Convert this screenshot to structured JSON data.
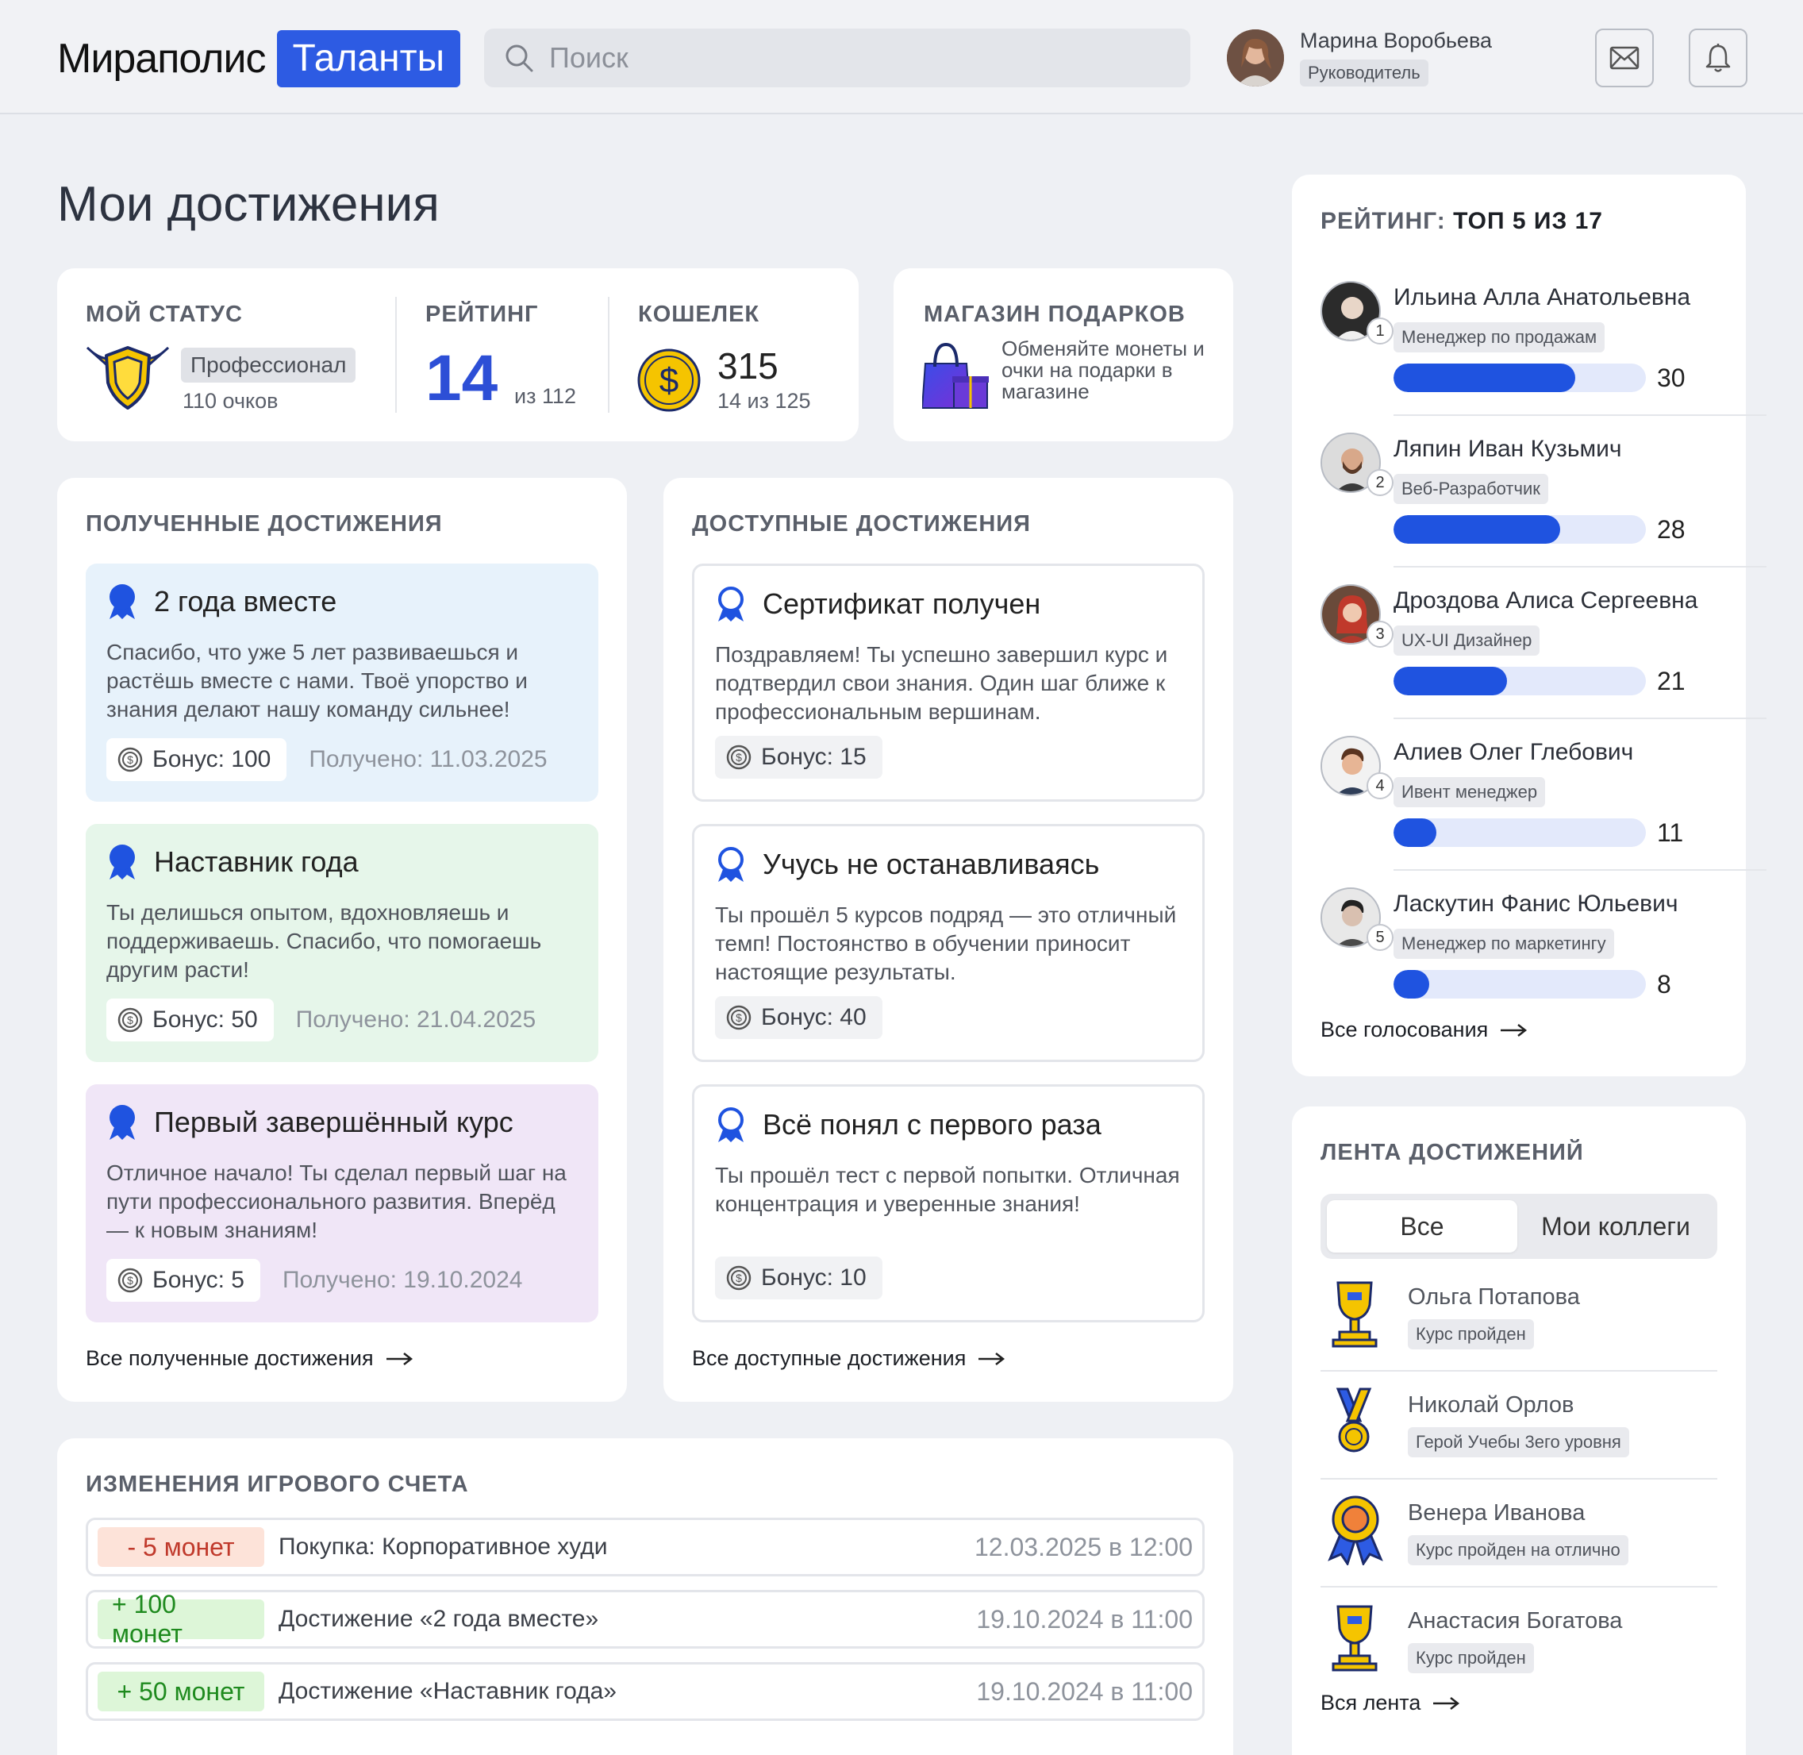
{
  "header": {
    "logo": "Мираполис",
    "logo_badge": "Таланты",
    "search_placeholder": "Поиск",
    "user_name": "Марина Воробьева",
    "user_role": "Руководитель"
  },
  "page_title": "Мои достижения",
  "status": {
    "label": "МОЙ СТАТУС",
    "level": "Профессионал",
    "points": "110 очков"
  },
  "rating": {
    "label": "РЕЙТИНГ",
    "value": "14",
    "total": "из 112"
  },
  "wallet": {
    "label": "КОШЕЛЕК",
    "value": "315",
    "sub": "14 из 125"
  },
  "shop": {
    "label": "МАГАЗИН ПОДАРКОВ",
    "text": "Обменяйте монеты и очки на подарки в магазине"
  },
  "received": {
    "title": "ПОЛУЧЕННЫЕ ДОСТИЖЕНИЯ",
    "items": [
      {
        "title": "2 года вместе",
        "text": "Спасибо, что уже 5 лет развиваешься и растёшь вместе с нами. Твоё упорство и знания делают нашу команду сильнее!",
        "bonus": "Бонус: 100",
        "date": "Получено: 11.03.2025",
        "color": "#e7f2fb"
      },
      {
        "title": "Наставник года",
        "text": "Ты делишься опытом, вдохновляешь и поддерживаешь. Спасибо, что помогаешь другим расти!",
        "bonus": "Бонус: 50",
        "date": "Получено: 21.04.2025",
        "color": "#e6f6ea"
      },
      {
        "title": "Первый завершённый курс",
        "text": "Отличное начало! Ты сделал первый шаг на пути профессионального развития. Вперёд — к новым знаниям!",
        "bonus": "Бонус: 5",
        "date": "Получено: 19.10.2024",
        "color": "#f0e6f7"
      }
    ],
    "link": "Все полученные достижения"
  },
  "available": {
    "title": "ДОСТУПНЫЕ ДОСТИЖЕНИЯ",
    "items": [
      {
        "title": "Сертификат получен",
        "text": "Поздравляем! Ты успешно завершил курс и подтвердил свои знания. Один шаг ближе к профессиональным вершинам.",
        "bonus": "Бонус: 15"
      },
      {
        "title": "Учусь не останавливаясь",
        "text": "Ты прошёл 5 курсов подряд — это отличный темп! Постоянство в обучении приносит настоящие результаты.",
        "bonus": "Бонус: 40"
      },
      {
        "title": "Всё понял с первого раза",
        "text": "Ты прошёл тест с первой попытки. Отличная концентрация и уверенные знания!",
        "bonus": "Бонус: 10"
      }
    ],
    "link": "Все доступные достижения"
  },
  "transactions": {
    "title": "ИЗМЕНЕНИЯ ИГРОВОГО СЧЕТА",
    "rows": [
      {
        "amount": "- 5 монет",
        "desc": "Покупка: Корпоративное худи",
        "date": "12.03.2025 в 12:00",
        "type": "neg"
      },
      {
        "amount": "+ 100 монет",
        "desc": "Достижение «2 года вместе»",
        "date": "19.10.2024 в 11:00",
        "type": "pos"
      },
      {
        "amount": "+ 50 монет",
        "desc": "Достижение «Наставник года»",
        "date": "19.10.2024 в 11:00",
        "type": "pos"
      }
    ]
  },
  "ranking": {
    "title_prefix": "РЕЙТИНГ:",
    "title_suffix": "ТОП 5 ИЗ 17",
    "items": [
      {
        "rank": "1",
        "name": "Ильина Алла Анатольевна",
        "role": "Менеджер по продажам",
        "score": "30",
        "fill": 0.72
      },
      {
        "rank": "2",
        "name": "Ляпин Иван Кузьмич",
        "role": "Веб-Разработчик",
        "score": "28",
        "fill": 0.66
      },
      {
        "rank": "3",
        "name": "Дроздова Алиса Сергеевна",
        "role": "UX-UI Дизайнер",
        "score": "21",
        "fill": 0.45
      },
      {
        "rank": "4",
        "name": "Алиев Олег Глебович",
        "role": "Ивент менеджер",
        "score": "11",
        "fill": 0.17
      },
      {
        "rank": "5",
        "name": "Ласкутин Фанис Юльевич",
        "role": "Менеджер по маркетингу",
        "score": "8",
        "fill": 0.14
      }
    ],
    "link": "Все голосования"
  },
  "feed": {
    "title": "ЛЕНТА ДОСТИЖЕНИЙ",
    "tab_all": "Все",
    "tab_colleagues": "Мои коллеги",
    "items": [
      {
        "name": "Ольга Потапова",
        "tag": "Курс пройден",
        "icon": "cup-icon"
      },
      {
        "name": "Николай Орлов",
        "tag": "Герой Учебы 3его уровня",
        "icon": "medal-icon"
      },
      {
        "name": "Венера Иванова",
        "tag": "Курс пройден на отлично",
        "icon": "rosette-icon"
      },
      {
        "name": "Анастасия Богатова",
        "tag": "Курс пройден",
        "icon": "cup-icon"
      }
    ],
    "link": "Вся лента"
  }
}
